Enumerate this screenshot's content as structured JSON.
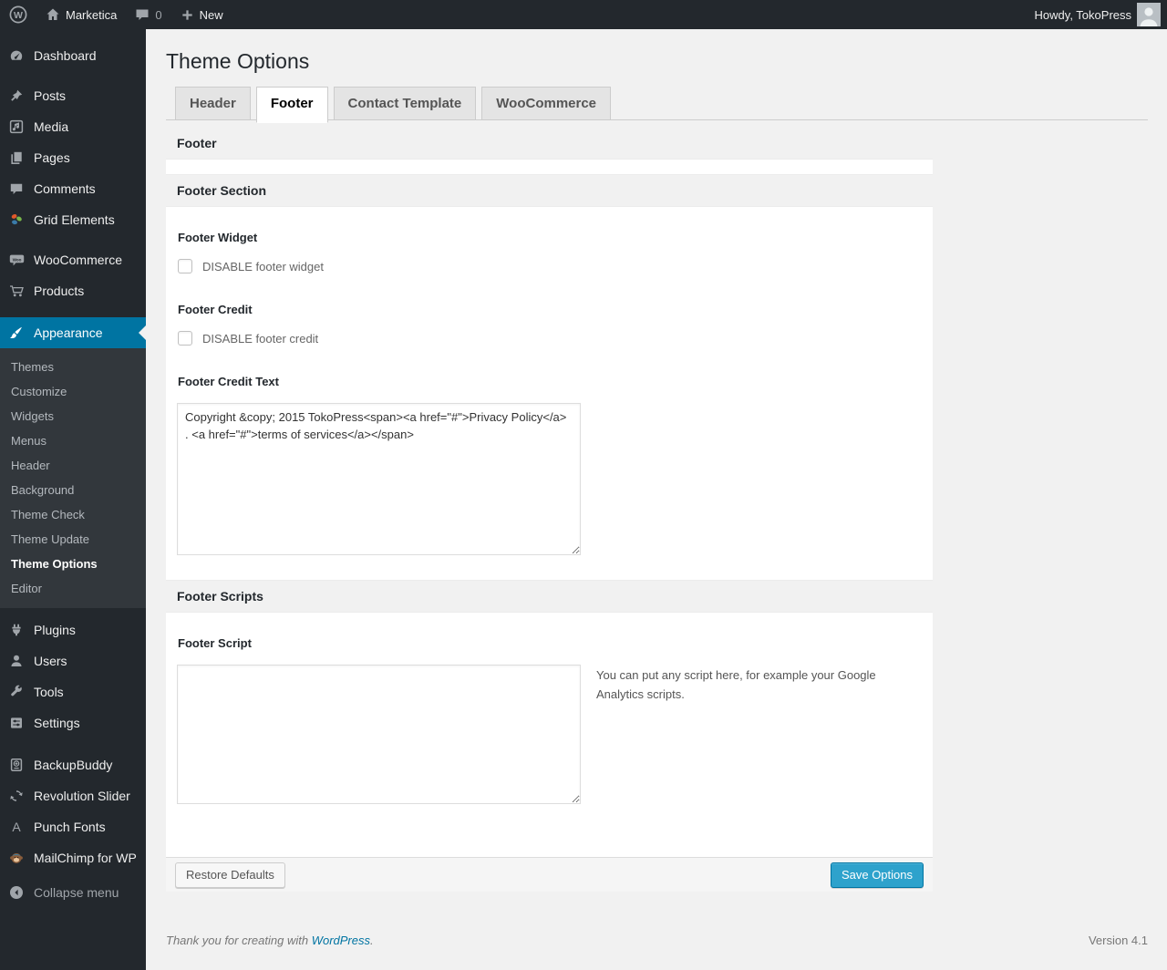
{
  "admin_bar": {
    "site_name": "Marketica",
    "comment_count": "0",
    "new_label": "New",
    "greeting": "Howdy, TokoPress",
    "icons": [
      "wordpress-logo-icon",
      "home-icon",
      "comments-bubble-icon",
      "plus-icon",
      "avatar"
    ]
  },
  "sidebar": {
    "menu_top": [
      {
        "label": "Dashboard",
        "icon": "dashboard-icon"
      },
      {
        "label": "Posts",
        "icon": "pin-icon"
      },
      {
        "label": "Media",
        "icon": "media-icon"
      },
      {
        "label": "Pages",
        "icon": "pages-icon"
      },
      {
        "label": "Comments",
        "icon": "comments-icon"
      },
      {
        "label": "Grid Elements",
        "icon": "grid-elements-icon"
      }
    ],
    "menu_commerce": [
      {
        "label": "WooCommerce",
        "icon": "woocommerce-icon"
      },
      {
        "label": "Products",
        "icon": "cart-icon"
      }
    ],
    "appearance": {
      "label": "Appearance",
      "icon": "brush-icon"
    },
    "appearance_submenu": [
      "Themes",
      "Customize",
      "Widgets",
      "Menus",
      "Header",
      "Background",
      "Theme Check",
      "Theme Update",
      "Theme Options",
      "Editor"
    ],
    "menu_lower": [
      {
        "label": "Plugins",
        "icon": "plugin-icon"
      },
      {
        "label": "Users",
        "icon": "user-icon"
      },
      {
        "label": "Tools",
        "icon": "wrench-icon"
      },
      {
        "label": "Settings",
        "icon": "settings-icon"
      }
    ],
    "menu_plugins": [
      {
        "label": "BackupBuddy",
        "icon": "backup-icon"
      },
      {
        "label": "Revolution Slider",
        "icon": "refresh-icon"
      },
      {
        "label": "Punch Fonts",
        "icon": "letter-a-icon"
      },
      {
        "label": "MailChimp for WP",
        "icon": "monkey-icon"
      }
    ],
    "collapse_label": "Collapse menu"
  },
  "page": {
    "title": "Theme Options",
    "tabs": [
      {
        "label": "Header",
        "active": false
      },
      {
        "label": "Footer",
        "active": true
      },
      {
        "label": "Contact Template",
        "active": false
      },
      {
        "label": "WooCommerce",
        "active": false
      }
    ],
    "panel": {
      "header": "Footer",
      "section_title": "Footer Section",
      "footer_widget": {
        "label": "Footer Widget",
        "checkbox_label": "DISABLE footer widget",
        "checked": false
      },
      "footer_credit": {
        "label": "Footer Credit",
        "checkbox_label": "DISABLE footer credit",
        "checked": false
      },
      "footer_credit_text": {
        "label": "Footer Credit Text",
        "value": "Copyright &copy; 2015 TokoPress<span><a href=\"#\">Privacy Policy</a> . <a href=\"#\">terms of services</a></span>"
      },
      "scripts_section_title": "Footer Scripts",
      "footer_script": {
        "label": "Footer Script",
        "value": "",
        "hint": "You can put any script here, for example your Google Analytics scripts."
      },
      "restore_button": "Restore Defaults",
      "save_button": "Save Options"
    },
    "footer": {
      "thanks_text": "Thank you for creating with",
      "wordpress_link": "WordPress",
      "period": ".",
      "version": "Version 4.1"
    }
  },
  "colors": {
    "admin_dark": "#23282d",
    "menu_highlight": "#0074a2",
    "submenu_bg": "#32373c",
    "page_bg": "#f1f1f1",
    "primary_button": "#2ea2cc",
    "link_blue": "#0074a2"
  }
}
